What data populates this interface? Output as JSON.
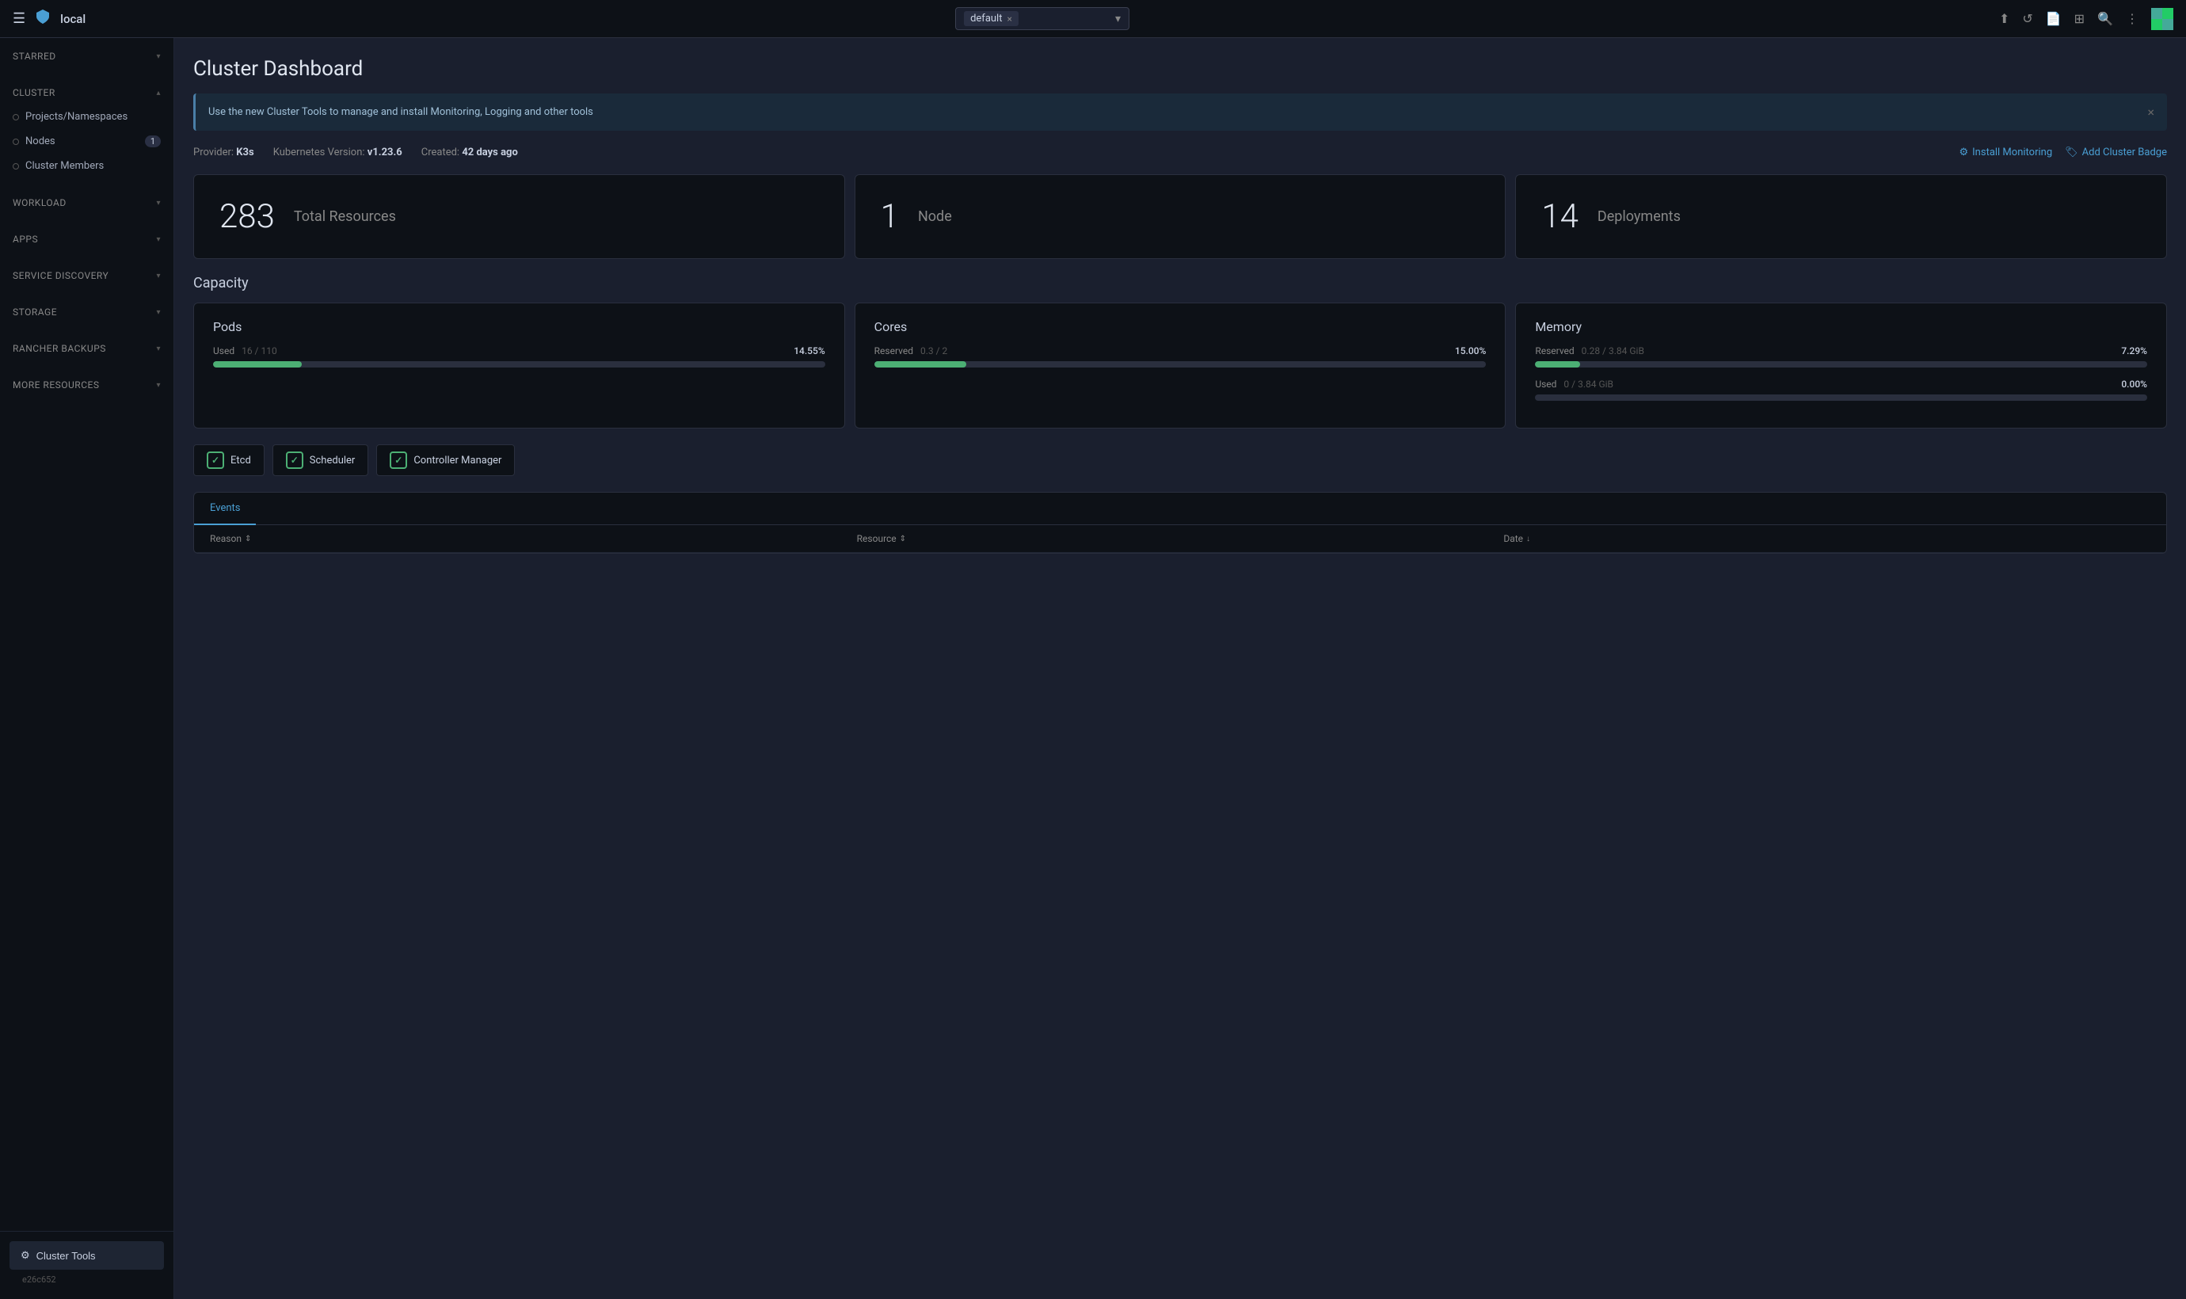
{
  "topbar": {
    "hamburger_icon": "☰",
    "logo_icon": "👕",
    "cluster_name": "local",
    "namespace": "default",
    "ns_close": "×",
    "icons": [
      "⬆",
      "↺",
      "📄",
      "⊞",
      "🔍",
      "⋮"
    ],
    "avatar_text": ""
  },
  "sidebar": {
    "starred_label": "Starred",
    "cluster_label": "Cluster",
    "items": [
      {
        "label": "Projects/Namespaces",
        "count": null
      },
      {
        "label": "Nodes",
        "count": "1"
      },
      {
        "label": "Cluster Members",
        "count": null
      }
    ],
    "workload_label": "Workload",
    "apps_label": "Apps",
    "service_discovery_label": "Service Discovery",
    "storage_label": "Storage",
    "rancher_backups_label": "Rancher Backups",
    "more_resources_label": "More Resources",
    "cluster_tools_label": "Cluster Tools",
    "gear_icon": "⚙",
    "version": "e26c652"
  },
  "main": {
    "title": "Cluster Dashboard",
    "banner": {
      "text": "Use the new Cluster Tools to manage and install Monitoring, Logging and other tools",
      "close": "×"
    },
    "meta": {
      "provider_label": "Provider:",
      "provider_value": "K3s",
      "k8s_label": "Kubernetes Version:",
      "k8s_value": "v1.23.6",
      "created_label": "Created:",
      "created_value": "42 days ago",
      "install_monitoring": "Install Monitoring",
      "add_cluster_badge": "Add Cluster Badge",
      "gear_icon": "⚙",
      "badge_icon": "🏷"
    },
    "stats": [
      {
        "number": "283",
        "label": "Total Resources"
      },
      {
        "number": "1",
        "label": "Node"
      },
      {
        "number": "14",
        "label": "Deployments"
      }
    ],
    "capacity": {
      "title": "Capacity",
      "cards": [
        {
          "title": "Pods",
          "rows": [
            {
              "label": "Used",
              "values": "16 / 110",
              "percent": "14.55%",
              "fill_pct": 14.55
            }
          ]
        },
        {
          "title": "Cores",
          "rows": [
            {
              "label": "Reserved",
              "values": "0.3 / 2",
              "percent": "15.00%",
              "fill_pct": 15
            }
          ]
        },
        {
          "title": "Memory",
          "rows": [
            {
              "label": "Reserved",
              "values": "0.28 / 3.84 GiB",
              "percent": "7.29%",
              "fill_pct": 7.29
            },
            {
              "label": "Used",
              "values": "0 / 3.84 GiB",
              "percent": "0.00%",
              "fill_pct": 0
            }
          ]
        }
      ]
    },
    "status_badges": [
      {
        "label": "Etcd",
        "status": "ok"
      },
      {
        "label": "Scheduler",
        "status": "ok"
      },
      {
        "label": "Controller Manager",
        "status": "ok"
      }
    ],
    "events": {
      "tab_label": "Events",
      "columns": [
        {
          "label": "Reason",
          "sort": "⇕"
        },
        {
          "label": "Resource",
          "sort": "⇕"
        },
        {
          "label": "Date",
          "sort": "↓"
        }
      ]
    }
  }
}
